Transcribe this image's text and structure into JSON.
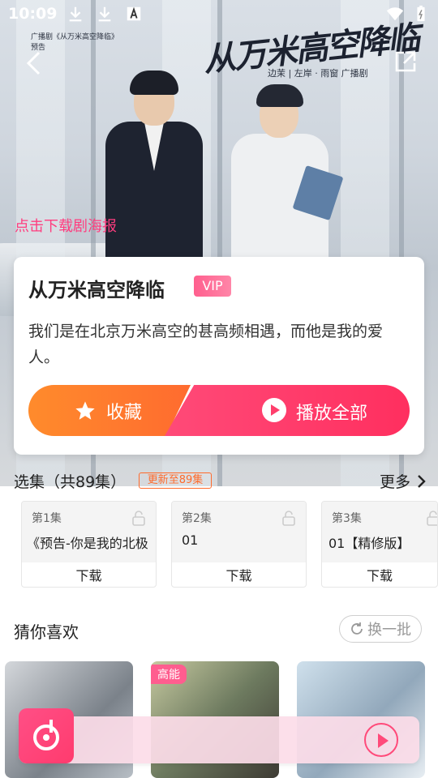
{
  "status_bar": {
    "time": "10:09",
    "icons": [
      "download-icon",
      "download-icon",
      "a-notification-icon"
    ],
    "right_icons": [
      "wifi-icon",
      "battery-icon"
    ]
  },
  "poster": {
    "title_art": "从万米高空降临",
    "credits": "边茉 | 左岸 · 雨窗 广播剧",
    "small_caption": "广播剧《从万米高空降临》\n预告",
    "download_label": "点击下载剧海报"
  },
  "header": {
    "back_icon": "back-arrow-icon",
    "share_icon": "share-icon"
  },
  "drama": {
    "title": "从万米高空降临",
    "badge": "VIP",
    "description": "我们是在北京万米高空的甚高频相遇，而他是我的爱人。",
    "favorite_label": "收藏",
    "play_all_label": "播放全部"
  },
  "episodes": {
    "header": "选集（共89集）",
    "update_badge": "更新至89集",
    "more_label": "更多",
    "items": [
      {
        "num": "第1集",
        "title": "《预告-你是我的北极",
        "download": "下载"
      },
      {
        "num": "第2集",
        "title": "01",
        "download": "下载"
      },
      {
        "num": "第3集",
        "title": "01【精修版】",
        "download": "下载"
      }
    ]
  },
  "recommend": {
    "title": "猜你喜欢",
    "refresh_label": "换一批",
    "items": [
      {
        "badge": ""
      },
      {
        "badge": "高能"
      },
      {
        "badge": ""
      }
    ]
  },
  "colors": {
    "accent_pink": "#ff3f6c",
    "accent_orange": "#ff7a2e",
    "vip_pink": "#ff5f8e"
  }
}
